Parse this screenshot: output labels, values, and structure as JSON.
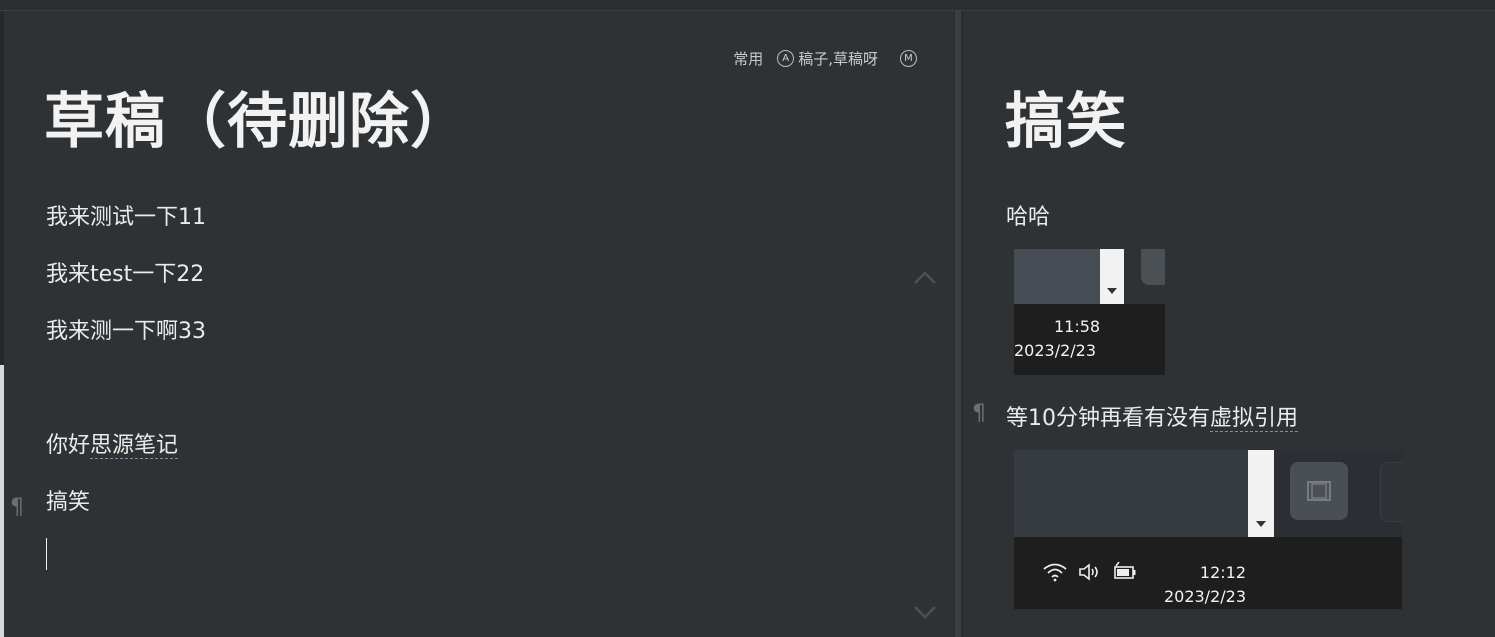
{
  "left_doc": {
    "meta": {
      "tag": "常用",
      "alias_badge": "A",
      "alias": "稿子,草稿呀",
      "memo_badge": "M"
    },
    "title": "草稿（待删除）",
    "paragraphs": [
      "我来测试一下11",
      "我来test一下22",
      "我来测一下啊33"
    ],
    "greeting_prefix": "你好",
    "greeting_ref": "思源笔记",
    "last_block": "搞笑",
    "pilcrow": "¶"
  },
  "right_doc": {
    "title": "搞笑",
    "first_para": "哈哈",
    "screenshot1": {
      "time": "11:58",
      "date": "2023/2/23"
    },
    "wait_text": "等10分钟再看有没有",
    "wait_ref": "虚拟引用",
    "pilcrow": "¶",
    "screenshot2": {
      "time": "12:12",
      "date": "2023/2/23"
    }
  },
  "icons": [
    "chevron-up-icon",
    "chevron-down-icon",
    "wifi-icon",
    "volume-icon",
    "battery-icon",
    "window-icon",
    "dropdown-arrow-icon"
  ]
}
